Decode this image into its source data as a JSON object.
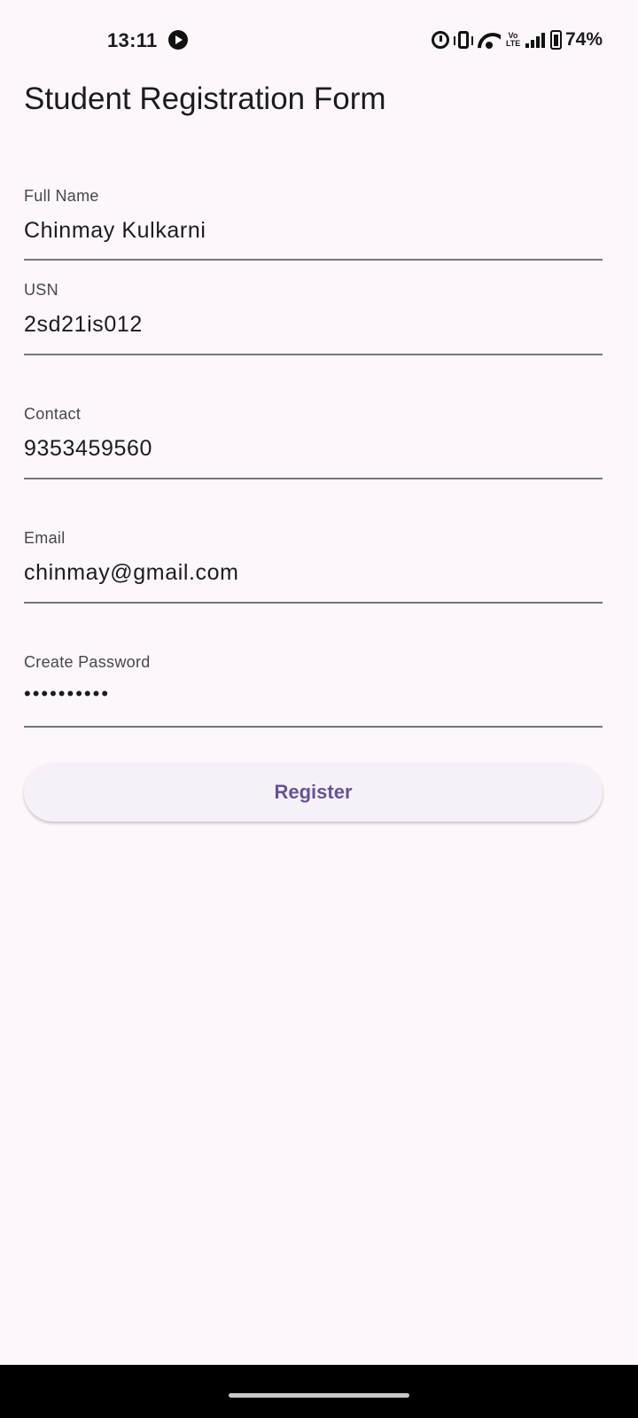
{
  "status_bar": {
    "time": "13:11",
    "battery": "74%",
    "network_type": "Vo\nLTE",
    "icons": [
      "media-play-icon",
      "alarm-icon",
      "vibrate-icon",
      "wifi-icon",
      "volte-icon",
      "signal-icon",
      "battery-icon"
    ]
  },
  "form": {
    "title": "Student Registration Form",
    "fields": [
      {
        "label": "Full Name",
        "value": "Chinmay Kulkarni"
      },
      {
        "label": "USN",
        "value": "2sd21is012"
      },
      {
        "label": "Contact",
        "value": "9353459560"
      },
      {
        "label": "Email",
        "value": "chinmay@gmail.com"
      },
      {
        "label": "Create Password",
        "value": "••••••••••"
      }
    ],
    "submit_label": "Register"
  },
  "colors": {
    "background": "#fdf7fc",
    "accent": "#65558f",
    "button_bg": "#f6f1f8",
    "underline": "#79747e"
  }
}
